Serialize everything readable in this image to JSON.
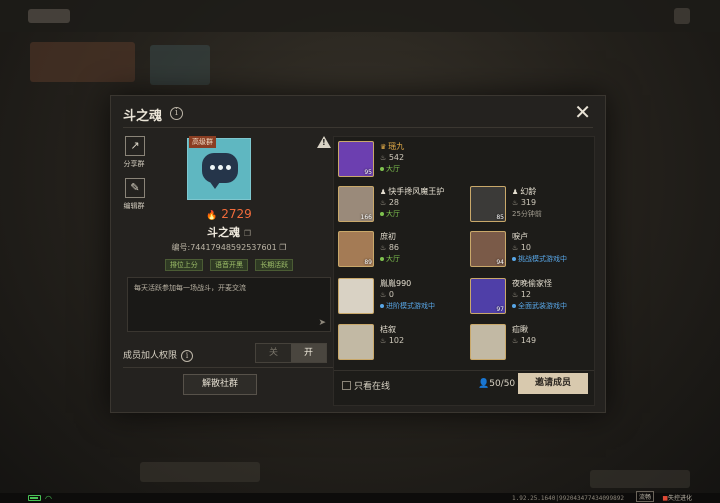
{
  "modal": {
    "title": "斗之魂",
    "share_label": "分享群",
    "edit_label": "编辑群",
    "tier_badge": "高级群",
    "hot_score": "2729",
    "guild_name": "斗之魂",
    "guild_id": "编号:74417948592537601",
    "tags": [
      "排位上分",
      "语音开黑",
      "长期活跃"
    ],
    "notice": "每天活跃参加每一场战斗，开麦交流",
    "permission_label": "成员加人权限",
    "toggle_off": "关",
    "toggle_on": "开",
    "disband_label": "解散社群",
    "online_only_label": "只看在线",
    "member_count": "50/50",
    "invite_label": "邀请成员"
  },
  "members": [
    {
      "name": "瑶九",
      "score": "542",
      "status": "大厅",
      "status_type": "green",
      "level": "95",
      "role": "owner"
    },
    {
      "name": "快手搀风魔王护",
      "score": "28",
      "status": "大厅",
      "status_type": "green",
      "level": "166",
      "role": "admin"
    },
    {
      "name": "幻龄",
      "score": "319",
      "status": "25分钟前",
      "status_type": "gray",
      "level": "85",
      "role": "admin"
    },
    {
      "name": "庶初",
      "score": "86",
      "status": "大厅",
      "status_type": "green",
      "level": "89",
      "role": ""
    },
    {
      "name": "唳卢",
      "score": "10",
      "status": "挑战模式游戏中",
      "status_type": "blue",
      "level": "94",
      "role": ""
    },
    {
      "name": "胤胤990",
      "score": "0",
      "status": "进阶模式游戏中",
      "status_type": "blue",
      "level": "",
      "role": ""
    },
    {
      "name": "夜晚偷家怪",
      "score": "12",
      "status": "全面武装游戏中",
      "status_type": "blue",
      "level": "97",
      "role": ""
    },
    {
      "name": "桔叙",
      "score": "102",
      "status": "",
      "status_type": "",
      "level": "",
      "role": ""
    },
    {
      "name": "疝瞅",
      "score": "149",
      "status": "",
      "status_type": "",
      "level": "",
      "role": ""
    }
  ],
  "footer": {
    "version": "1.92.25.1640|992043477434099892",
    "button_a": "流畅",
    "button_b": "失控进化"
  },
  "colors": {
    "accent_orange": "#f26b3b",
    "status_green": "#7ec24f",
    "status_blue": "#58a6e6",
    "invite_button": "#d8c9ae"
  }
}
